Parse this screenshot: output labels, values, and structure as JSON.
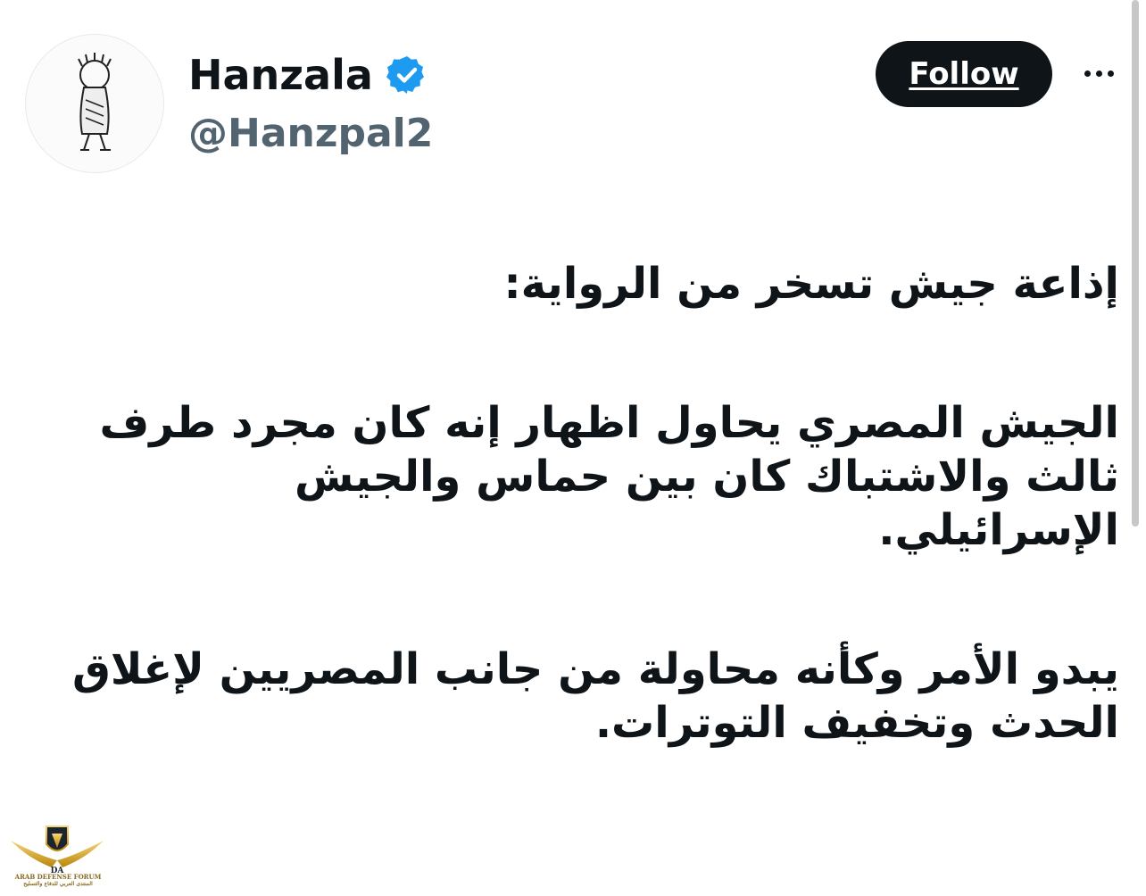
{
  "profile": {
    "display_name": "Hanzala",
    "handle": "@Hanzpal2",
    "verified": true,
    "avatar_icon": "hanzala-cartoon-avatar"
  },
  "actions": {
    "follow_label": "Follow",
    "more_icon": "more-horizontal-icon"
  },
  "tweet": {
    "paragraphs": [
      [
        "إذاعة جيش تسخر من الرواية:"
      ],
      [
        "الجيش المصري يحاول اظهار إنه كان مجرد طرف",
        "ثالث والاشتباك كان بين حماس والجيش",
        "الإسرائيلي."
      ],
      [
        "يبدو الأمر وكأنه محاولة من جانب المصريين لإغلاق",
        "الحدث وتخفيف التوترات."
      ]
    ]
  },
  "watermark": {
    "logo_text": "ARAB DEFENSE FORUM",
    "logo_subtext": "المنتدى العربي للدفاع والتسليح"
  },
  "colors": {
    "text_primary": "#0f1419",
    "text_secondary": "#536471",
    "verified_blue": "#1d9bf0",
    "follow_bg": "#0f1419"
  }
}
